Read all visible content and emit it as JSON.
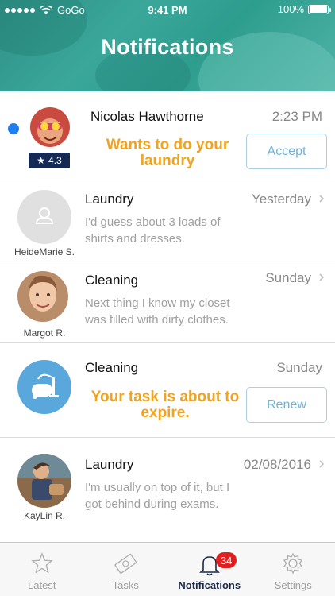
{
  "status_bar": {
    "carrier": "GoGo",
    "time": "9:41 PM",
    "battery": "100%"
  },
  "header": {
    "title": "Notifications"
  },
  "notifications": [
    {
      "name": "Nicolas Hawthorne",
      "time": "2:23 PM",
      "highlight": "Wants to do your laundry",
      "button": "Accept",
      "rating": "4.3",
      "unread": true
    },
    {
      "name": "Laundry",
      "time": "Yesterday",
      "message": "I'd guess about 3 loads of shirts and dresses.",
      "avatar_name": "HeideMarie S."
    },
    {
      "name": "Cleaning",
      "time": "Sunday",
      "message": "Next thing I know my closet was filled with dirty clothes.",
      "avatar_name": "Margot R."
    },
    {
      "name": "Cleaning",
      "time": "Sunday",
      "highlight": "Your task is about to expire.",
      "button": "Renew"
    },
    {
      "name": "Laundry",
      "time": "02/08/2016",
      "message": "I'm usually on top of it, but I got behind during exams.",
      "avatar_name": "KayLin R."
    }
  ],
  "tabbar": {
    "tabs": [
      {
        "label": "Latest",
        "icon": "star-icon"
      },
      {
        "label": "Tasks",
        "icon": "money-icon"
      },
      {
        "label": "Notifications",
        "icon": "bell-icon",
        "badge": "34",
        "active": true
      },
      {
        "label": "Settings",
        "icon": "gear-icon"
      }
    ]
  },
  "colors": {
    "accent_orange": "#f2a31c",
    "button_blue": "#6fb3d8",
    "unread_blue": "#1f7ff0",
    "rating_navy": "#142a55",
    "badge_red": "#e02020",
    "header_teal": "#2f8f86"
  }
}
